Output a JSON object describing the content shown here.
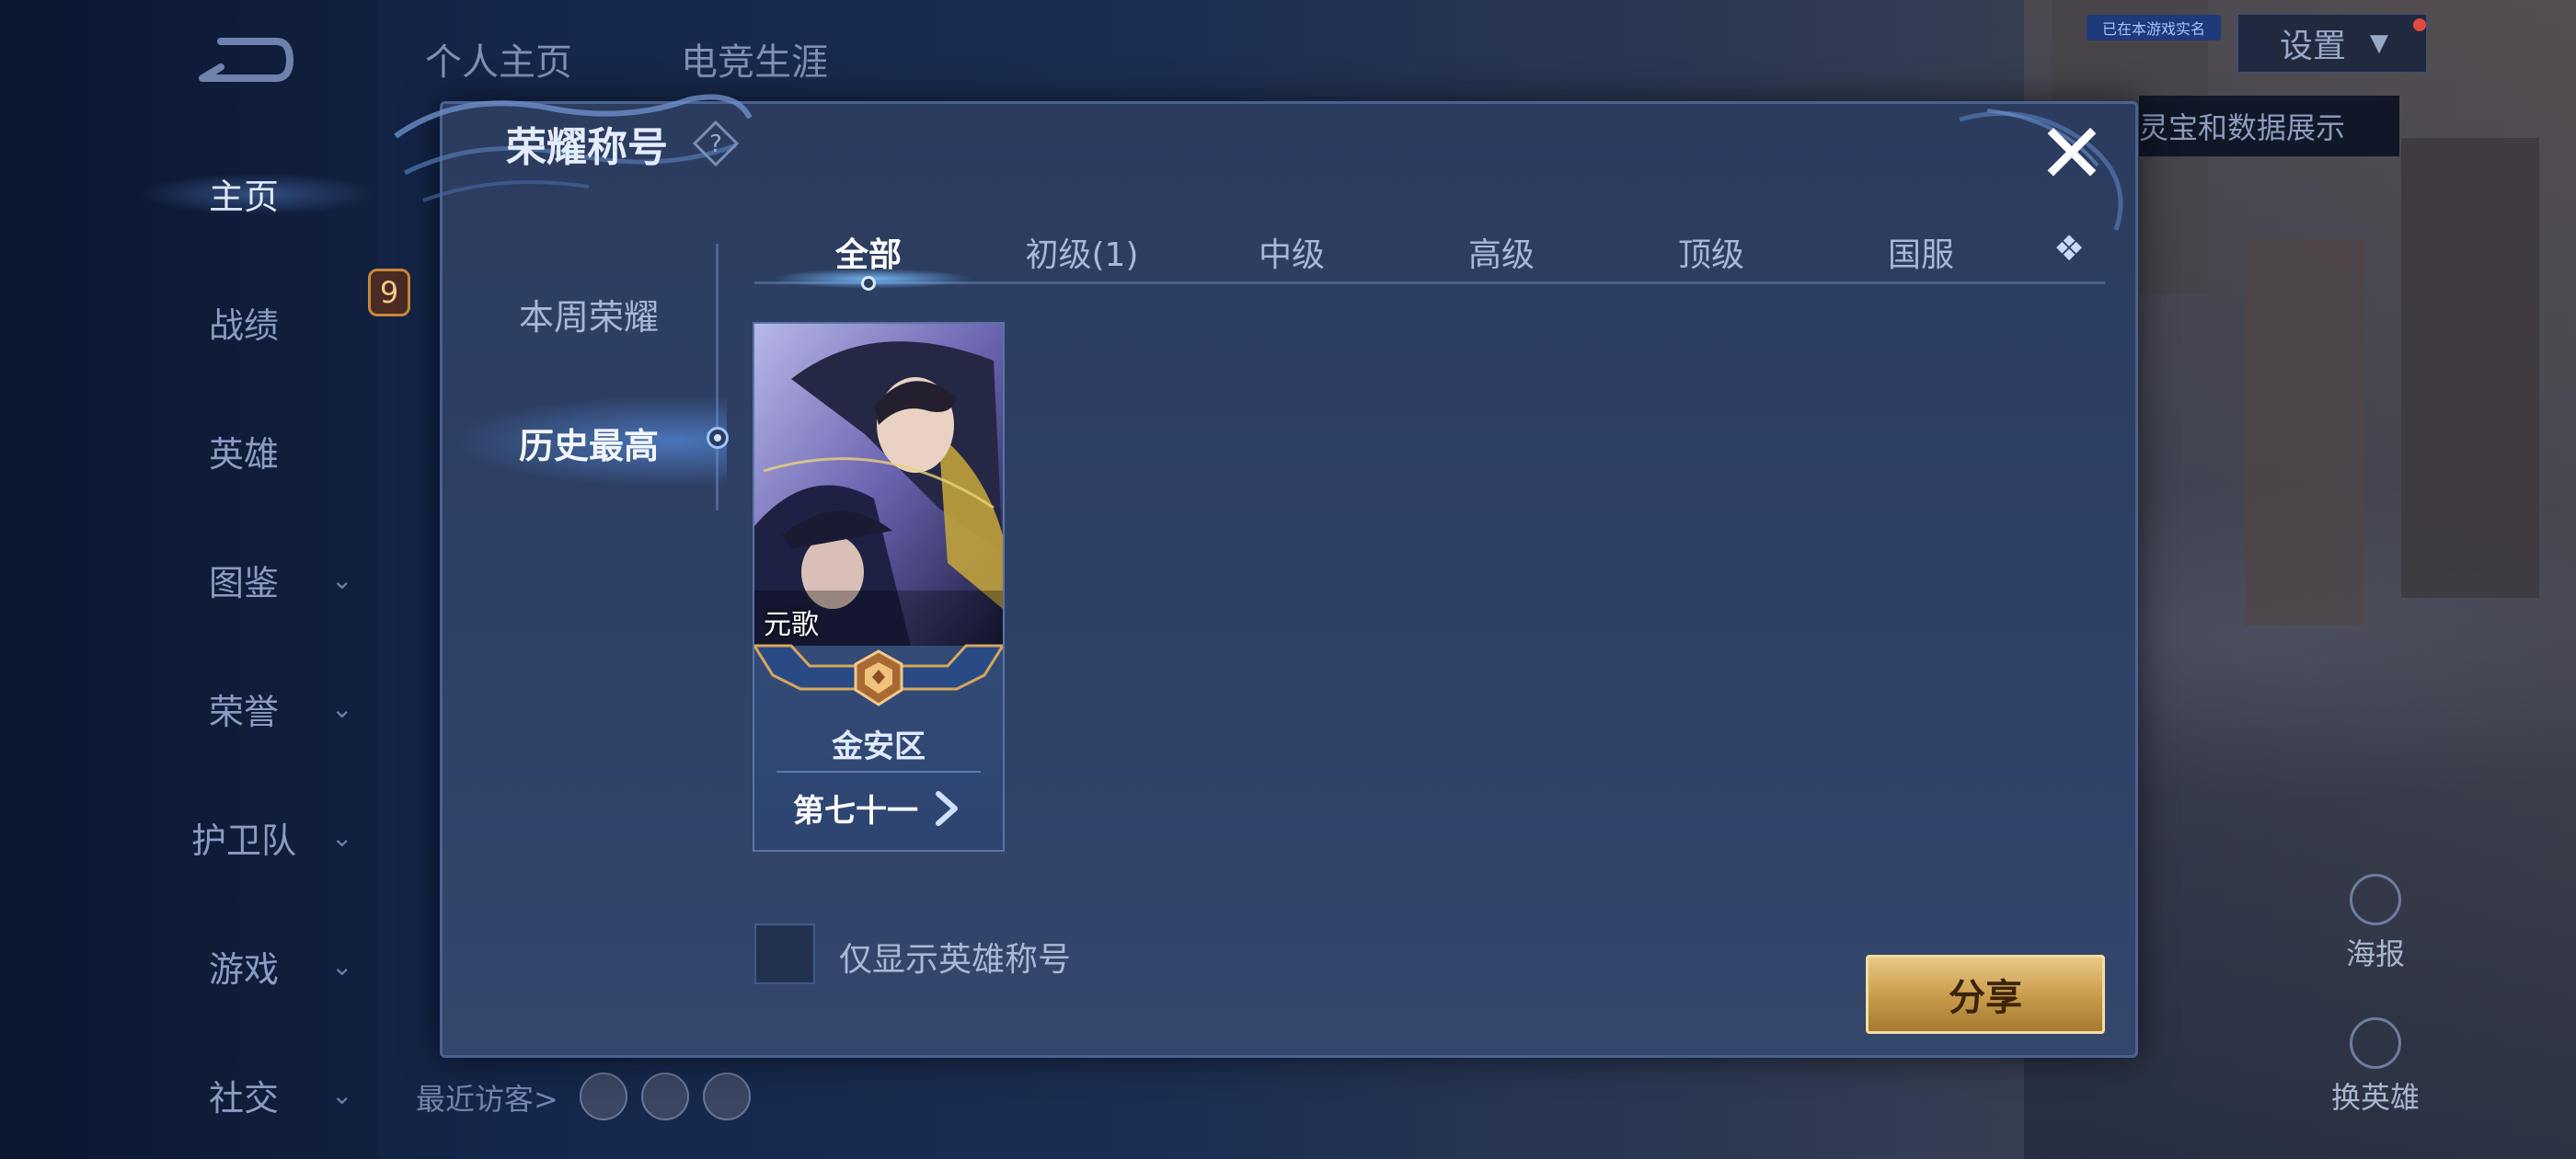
{
  "background": {
    "top_tabs": [
      "个人主页",
      "电竞生涯"
    ],
    "settings_label": "设置",
    "mini_badge": "已在本游戏实名",
    "tooltip_text": "灵宝和数据展示",
    "right_buttons": [
      {
        "label": "海报",
        "icon": "poster-icon"
      },
      {
        "label": "换英雄",
        "icon": "swap-hero-icon"
      }
    ],
    "recent_visitors_label": "最近访客>",
    "peek_level": "9"
  },
  "left_nav": {
    "items": [
      {
        "label": "主页",
        "active": true,
        "has_chevron": false
      },
      {
        "label": "战绩",
        "active": false,
        "has_chevron": false
      },
      {
        "label": "英雄",
        "active": false,
        "has_chevron": false
      },
      {
        "label": "图鉴",
        "active": false,
        "has_chevron": true
      },
      {
        "label": "荣誉",
        "active": false,
        "has_chevron": true
      },
      {
        "label": "护卫队",
        "active": false,
        "has_chevron": true
      },
      {
        "label": "游戏",
        "active": false,
        "has_chevron": true
      },
      {
        "label": "社交",
        "active": false,
        "has_chevron": true
      }
    ],
    "chevron_glyph": "⌄"
  },
  "dialog": {
    "title": "荣耀称号",
    "help_glyph": "?",
    "close_glyph": "✕",
    "sidebar": [
      "本周荣耀",
      "历史最高"
    ],
    "sidebar_active": 1,
    "tabs": [
      "全部",
      "初级(1)",
      "中级",
      "高级",
      "顶级",
      "国服"
    ],
    "tab_active": 0,
    "tab_more_glyph": "❖",
    "card": {
      "hero_name": "元歌",
      "region": "金安区",
      "rank": "第七十一"
    },
    "checkbox_label": "仅显示英雄称号",
    "checkbox_checked": false,
    "share_label": "分享"
  },
  "colors": {
    "accent_gold": "#c79a4a",
    "dialog_bg": "#2e4064",
    "text_active": "#ffffff",
    "text_inactive": "#a9b8d8"
  }
}
